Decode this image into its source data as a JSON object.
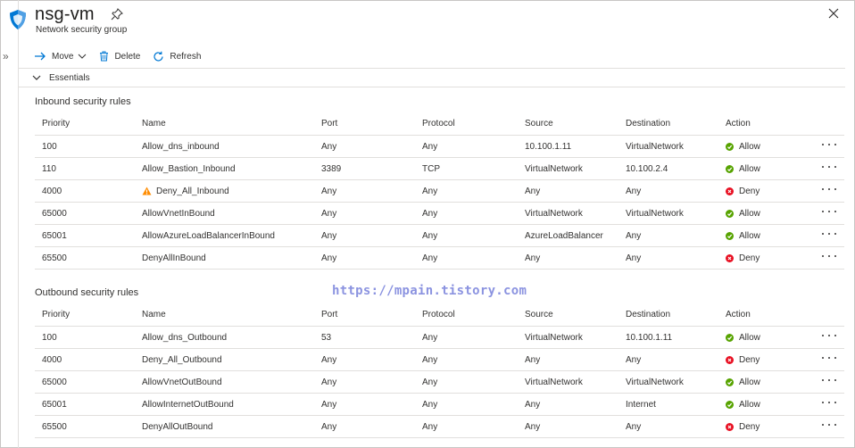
{
  "header": {
    "title": "nsg-vm",
    "subtitle": "Network security group"
  },
  "toolbar": {
    "move_label": "Move",
    "delete_label": "Delete",
    "refresh_label": "Refresh"
  },
  "essentials_label": "Essentials",
  "columns": [
    "Priority",
    "Name",
    "Port",
    "Protocol",
    "Source",
    "Destination",
    "Action"
  ],
  "inbound": {
    "title": "Inbound security rules",
    "rules": [
      {
        "priority": "100",
        "name": "Allow_dns_inbound",
        "warning": false,
        "port": "Any",
        "protocol": "Any",
        "source": "10.100.1.11",
        "destination": "VirtualNetwork",
        "action": "Allow"
      },
      {
        "priority": "110",
        "name": "Allow_Bastion_Inbound",
        "warning": false,
        "port": "3389",
        "protocol": "TCP",
        "source": "VirtualNetwork",
        "destination": "10.100.2.4",
        "action": "Allow"
      },
      {
        "priority": "4000",
        "name": "Deny_All_Inbound",
        "warning": true,
        "port": "Any",
        "protocol": "Any",
        "source": "Any",
        "destination": "Any",
        "action": "Deny"
      },
      {
        "priority": "65000",
        "name": "AllowVnetInBound",
        "warning": false,
        "port": "Any",
        "protocol": "Any",
        "source": "VirtualNetwork",
        "destination": "VirtualNetwork",
        "action": "Allow"
      },
      {
        "priority": "65001",
        "name": "AllowAzureLoadBalancerInBound",
        "warning": false,
        "port": "Any",
        "protocol": "Any",
        "source": "AzureLoadBalancer",
        "destination": "Any",
        "action": "Allow"
      },
      {
        "priority": "65500",
        "name": "DenyAllInBound",
        "warning": false,
        "port": "Any",
        "protocol": "Any",
        "source": "Any",
        "destination": "Any",
        "action": "Deny"
      }
    ]
  },
  "outbound": {
    "title": "Outbound security rules",
    "rules": [
      {
        "priority": "100",
        "name": "Allow_dns_Outbound",
        "warning": false,
        "port": "53",
        "protocol": "Any",
        "source": "VirtualNetwork",
        "destination": "10.100.1.11",
        "action": "Allow"
      },
      {
        "priority": "4000",
        "name": "Deny_All_Outbound",
        "warning": false,
        "port": "Any",
        "protocol": "Any",
        "source": "Any",
        "destination": "Any",
        "action": "Deny"
      },
      {
        "priority": "65000",
        "name": "AllowVnetOutBound",
        "warning": false,
        "port": "Any",
        "protocol": "Any",
        "source": "VirtualNetwork",
        "destination": "VirtualNetwork",
        "action": "Allow"
      },
      {
        "priority": "65001",
        "name": "AllowInternetOutBound",
        "warning": false,
        "port": "Any",
        "protocol": "Any",
        "source": "Any",
        "destination": "Internet",
        "action": "Allow"
      },
      {
        "priority": "65500",
        "name": "DenyAllOutBound",
        "warning": false,
        "port": "Any",
        "protocol": "Any",
        "source": "Any",
        "destination": "Any",
        "action": "Deny"
      }
    ]
  },
  "watermark": "https://mpain.tistory.com",
  "icons": {
    "header": "shield-icon",
    "pin": "pin-icon",
    "close": "close-icon",
    "move": "arrow-right-icon",
    "delete": "trash-icon",
    "refresh": "refresh-icon",
    "allow": "check-circle-icon",
    "deny": "x-circle-icon",
    "warning": "warning-triangle-icon",
    "more": "more-ellipsis-icon"
  },
  "colors": {
    "allow": "#57a300",
    "deny": "#e81123",
    "warning": "#ff8c00",
    "accent": "#0078d4",
    "watermark": "#8b93e0"
  }
}
